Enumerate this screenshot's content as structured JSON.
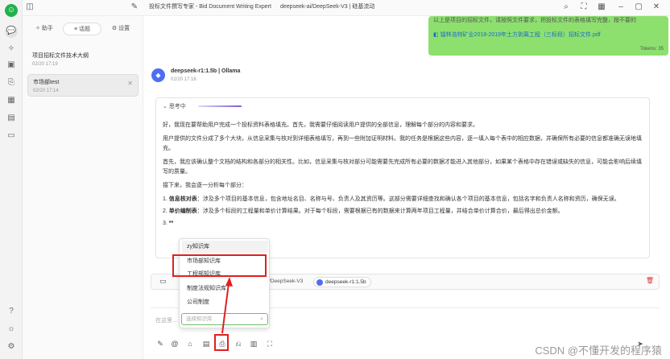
{
  "topbar": {
    "app_title": "投标文件撰写专家 - Bid Document Writing Expert",
    "model_title": "deepseek-ai/DeepSeek-V3 | 硅基流动"
  },
  "sidebar": {
    "tabs": [
      {
        "label": "助手",
        "icon": "sparkle-icon"
      },
      {
        "label": "话题",
        "icon": "list-icon"
      },
      {
        "label": "设置",
        "icon": "gear-icon"
      }
    ],
    "topics": [
      {
        "title": "项目招标文件技术大纲",
        "date": "02/20 17:19"
      },
      {
        "title": "市场部test",
        "date": "02/20 17:14"
      }
    ]
  },
  "user_message": {
    "text": "以上是项目的招标文件，请按照文件要求，把投标文件的表格填写完整，按不要的",
    "file": "镭林浩特矿业2018-2019年土方剥离工程（三标段）招标文件.pdf",
    "tokens": "Tokens: 35"
  },
  "assistant": {
    "avatar": "◆",
    "name": "deepseek-r1:1.5b | Ollama",
    "date": "02/20 17:16",
    "thinking_label": "思考中",
    "paragraphs": [
      "好，我现在要帮助用户完成一个投标资料表格填充。首先，我需要仔细阅读用户提供的全部信息，理解每个部分的内容和要求。",
      "用户提供的文件分成了多个大块，从信息采集与核对到详细表格填写，再到一些附加证明材料。我的任务是根据这些内容，逐一填入每个表中的相应数据，并确保所有必要的信息都准确无误地填充。",
      "首先，我应该确认整个文档的结构和各部分的相关性。比如，信息采集与核对部分可能需要先完成所有必要的数据才能进入其他部分，如果某个表格中存在错误或缺失的信息，可能会影响后续填写的质量。",
      "接下来，我会逐一分析每个部分："
    ],
    "list": [
      {
        "num": "1.",
        "head": "信息核对表",
        "text": "：涉及多个项目的基本信息，包含地址名目、名称与号、负责人及其资历等。这部分需要详细查找和确认各个项目的基本信息，包括名字和负责人名称和资历，确保无误。"
      },
      {
        "num": "2.",
        "head": "单价编制表",
        "text": "：涉及多个标段的工程量和单价计算结果。对于每个标段，需要根据已有的数据来计算两年项目工程量，并结合单价计算合价，最后得出总价金额。"
      },
      {
        "num": "3.",
        "head": "**",
        "text": ""
      }
    ]
  },
  "models_bar": {
    "model_1": "ai/DeepSeek-V3",
    "model_2": "deepseek-r1:1.5b"
  },
  "input": {
    "placeholder": "在这里..."
  },
  "knowledge_popup": {
    "items": [
      "zy知识库",
      "市场部知识库",
      "工程部知识库",
      "制度法规知识库",
      "公司制度"
    ],
    "search_placeholder": "选择知识库"
  },
  "watermark": "CSDN @不懂开发的程序猿"
}
